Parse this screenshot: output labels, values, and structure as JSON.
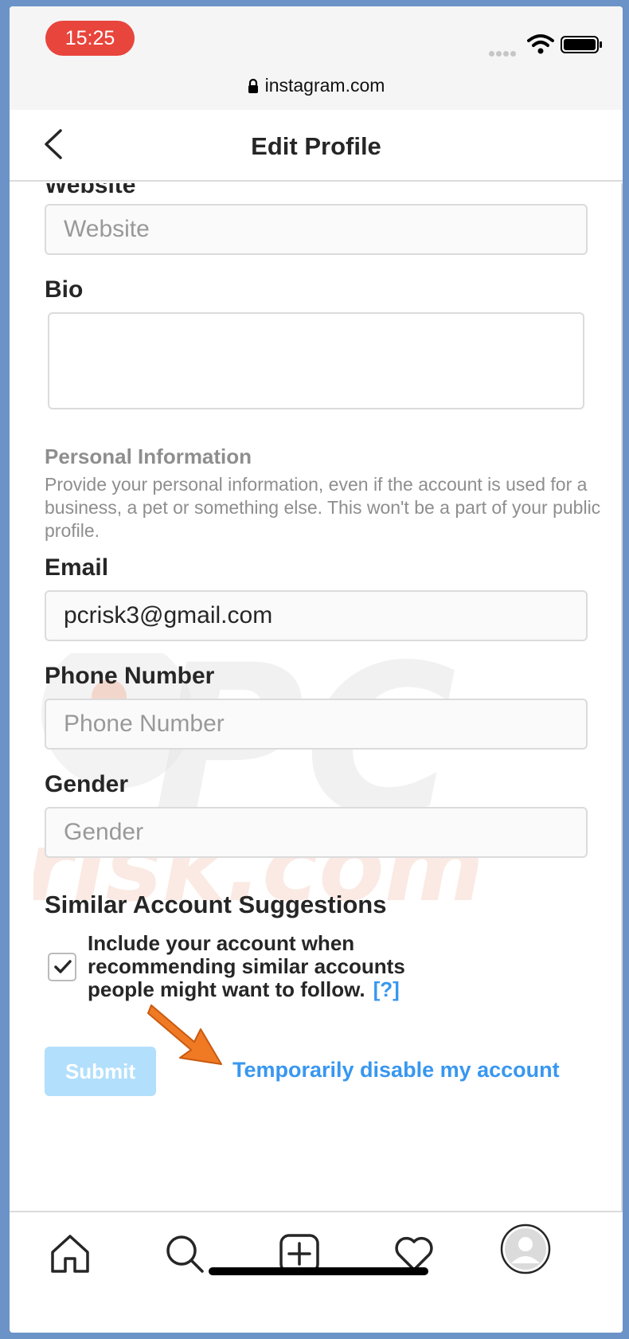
{
  "status_bar": {
    "time": "15:25"
  },
  "browser": {
    "url": "instagram.com"
  },
  "header": {
    "title": "Edit Profile"
  },
  "form": {
    "website_label": "Website",
    "website_placeholder": "Website",
    "bio_label": "Bio",
    "personal_info_title": "Personal Information",
    "personal_info_desc": "Provide your personal information, even if the account is used for a business, a pet or something else. This won't be a part of your public profile.",
    "email_label": "Email",
    "email_value": "pcrisk3@gmail.com",
    "phone_label": "Phone Number",
    "phone_placeholder": "Phone Number",
    "gender_label": "Gender",
    "gender_placeholder": "Gender",
    "suggestions_title": "Similar Account Suggestions",
    "suggestions_text": "Include your account when recommending similar accounts people might want to follow.",
    "suggestions_help": "[?]",
    "suggestions_checked": true,
    "submit_label": "Submit",
    "disable_link": "Temporarily disable my account"
  },
  "watermark": {
    "text": "PC risk.com"
  },
  "bottom_nav": {
    "items": [
      "home-icon",
      "search-icon",
      "add-post-icon",
      "activity-heart-icon",
      "profile-avatar-icon"
    ]
  },
  "colors": {
    "link_blue": "#3897f0",
    "submit_disabled": "#b2dffc",
    "time_pill": "#e8453c",
    "annotation_arrow": "#f07a24"
  }
}
